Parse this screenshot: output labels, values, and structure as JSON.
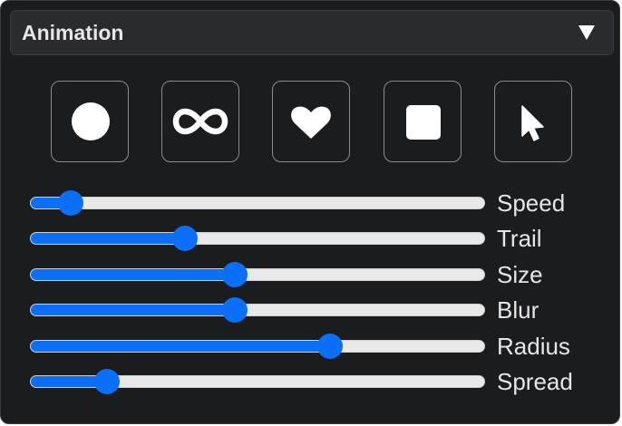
{
  "panel": {
    "title": "Animation",
    "toggle_icon": "triangle-down-icon"
  },
  "shapes": [
    {
      "name": "circle",
      "icon": "circle-icon"
    },
    {
      "name": "infinity",
      "icon": "infinity-icon"
    },
    {
      "name": "heart",
      "icon": "heart-icon"
    },
    {
      "name": "square",
      "icon": "square-icon"
    },
    {
      "name": "pointer",
      "icon": "cursor-pointer-icon"
    }
  ],
  "sliders": [
    {
      "label": "Speed",
      "value": 0.09
    },
    {
      "label": "Trail",
      "value": 0.34
    },
    {
      "label": "Size",
      "value": 0.45
    },
    {
      "label": "Blur",
      "value": 0.45
    },
    {
      "label": "Radius",
      "value": 0.66
    },
    {
      "label": "Spread",
      "value": 0.17
    }
  ],
  "colors": {
    "accent": "#0b6ff7",
    "background": "#1b1c1e",
    "header": "#2a2b2e",
    "text": "#e6e6e6"
  }
}
